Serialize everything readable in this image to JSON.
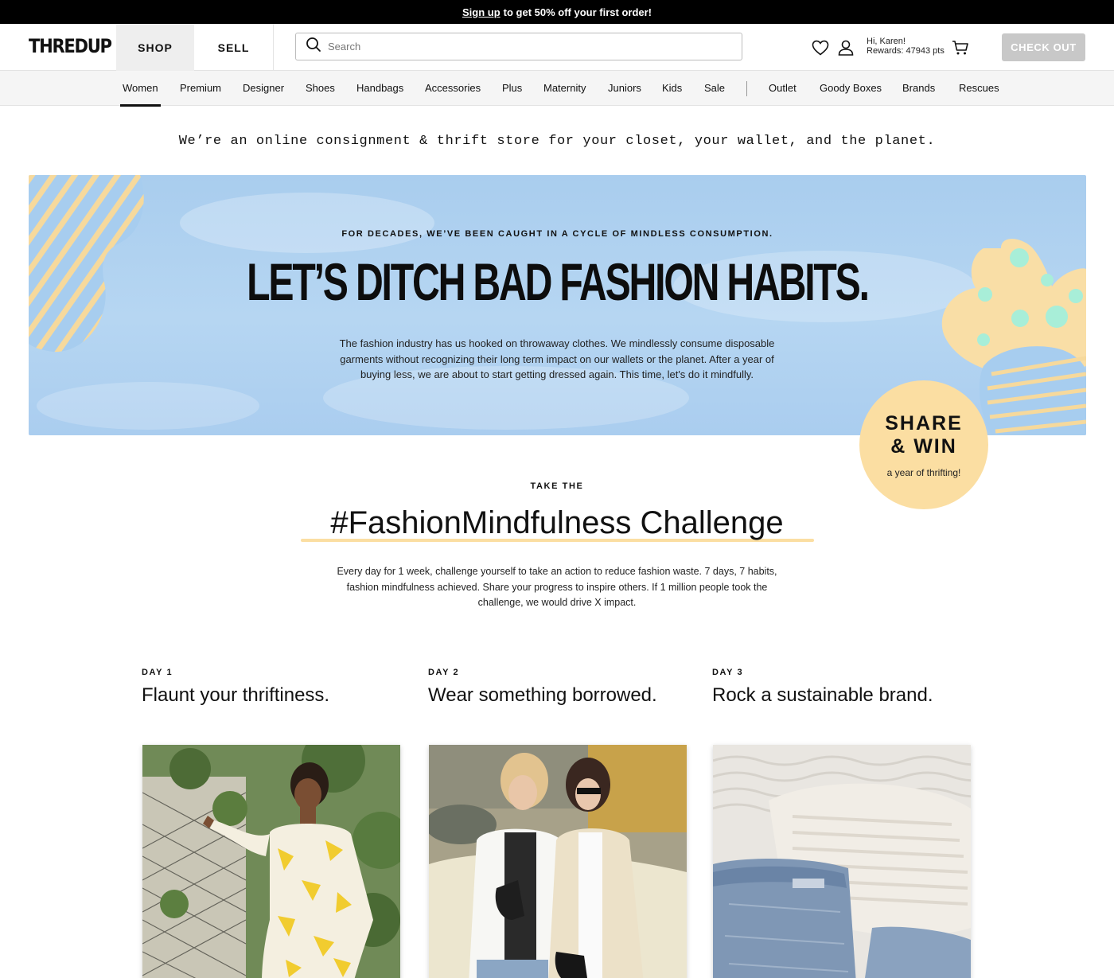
{
  "promo": {
    "link": "Sign up",
    "text": "to get 50% off your first order!"
  },
  "header": {
    "logo": "THREDUP",
    "tabs": {
      "shop": "SHOP",
      "sell": "SELL"
    },
    "search_placeholder": "Search",
    "user": {
      "greeting": "Hi, Karen!",
      "rewards": "Rewards: 47943 pts"
    },
    "checkout": "CHECK OUT"
  },
  "nav": {
    "items": [
      "Women",
      "Premium",
      "Designer",
      "Shoes",
      "Handbags",
      "Accessories",
      "Plus",
      "Maternity",
      "Juniors",
      "Kids",
      "Sale"
    ],
    "secondary": [
      "Outlet",
      "Goody Boxes",
      "Brands",
      "Rescues"
    ],
    "active": "Women"
  },
  "tagline": "We’re an online consignment & thrift store for your closet, your wallet, and the planet.",
  "hero": {
    "kicker": "FOR DECADES, WE’VE BEEN CAUGHT IN A CYCLE OF MINDLESS CONSUMPTION.",
    "title": "LET’S DITCH BAD FASHION HABITS.",
    "body": "The fashion industry has us hooked on throwaway clothes. We mindlessly consume disposable garments without recognizing their long term impact on our wallets or the planet. After a year of buying less, we are about to start getting dressed again. This time, let's do it mindfully."
  },
  "badge": {
    "line1": "SHARE",
    "line2": "& WIN",
    "sub": "a year of thrifting!"
  },
  "challenge": {
    "kicker": "TAKE THE",
    "title": "#FashionMindfulness Challenge",
    "body": "Every day for 1 week, challenge yourself to take an action to reduce fashion waste. 7 days, 7 habits, fashion mindfulness achieved. Share your progress to inspire others. If 1 million people took the challenge, we would drive X impact."
  },
  "days": [
    {
      "label": "DAY 1",
      "title": "Flaunt your thriftiness."
    },
    {
      "label": "DAY 2",
      "title": "Wear something borrowed."
    },
    {
      "label": "DAY 3",
      "title": "Rock a sustainable brand."
    }
  ],
  "colors": {
    "accent_yellow": "#fbdea2",
    "hero_blue": "#aecff0",
    "mint": "#a8eed8",
    "checkout_disabled": "#c8c8c8"
  }
}
